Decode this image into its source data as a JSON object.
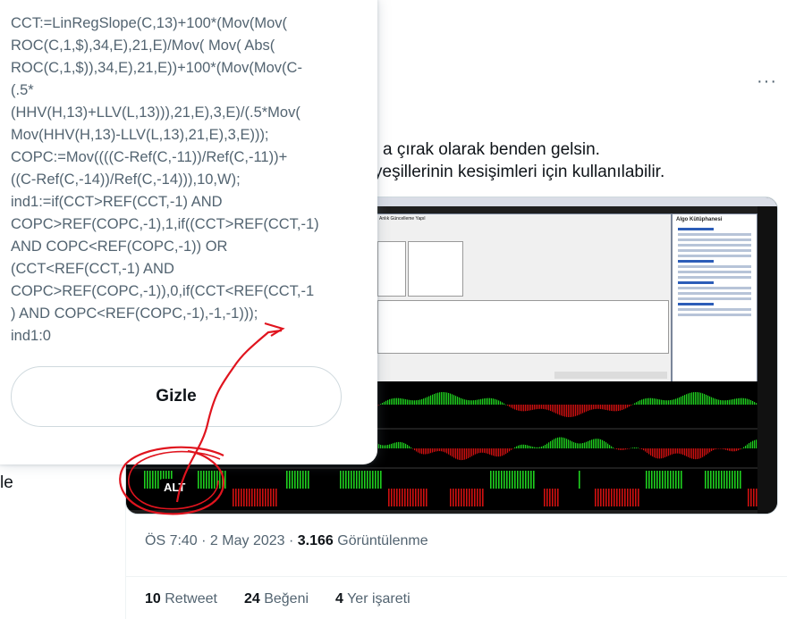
{
  "tweet": {
    "text_line1": "a çırak olarak benden gelsin.",
    "text_line2": "yeşillerinin kesişimleri için kullanılabilir.",
    "more_label": "···",
    "left_stub": "le",
    "timestamp": "ÖS 7:40 · 2 May 2023 · ",
    "views_count": "3.166",
    "views_label": " Görüntülenme",
    "retweets_count": "10",
    "retweets_label": "Retweet",
    "likes_count": "24",
    "likes_label": "Beğeni",
    "bookmarks_count": "4",
    "bookmarks_label": "Yer işareti"
  },
  "popup": {
    "code": "CCT:=LinRegSlope(C,13)+100*(Mov(Mov(\nROC(C,1,$),34,E),21,E)/Mov( Mov( Abs(\nROC(C,1,$)),34,E),21,E))+100*(Mov(Mov(C-\n(.5*\n(HHV(H,13)+LLV(L,13))),21,E),3,E)/(.5*Mov(\nMov(HHV(H,13)-LLV(L,13),21,E),3,E)));\nCOPC:=Mov((((C-Ref(C,-11))/Ref(C,-11))+\n((C-Ref(C,-14))/Ref(C,-14))),10,W);\nind1:=if(CCT>REF(CCT,-1) AND\nCOPC>REF(COPC,-1),1,if((CCT>REF(CCT,-1)\nAND COPC<REF(COPC,-1)) OR\n(CCT<REF(CCT,-1) AND\nCOPC>REF(COPC,-1)),0,if(CCT<REF(CCT,-1\n) AND COPC<REF(COPC,-1),-1,-1)));\nind1:0",
    "hide_button": "Gizle"
  },
  "image": {
    "alt_badge": "ALT",
    "side_panel_title": "Algo Kütüphanesi",
    "dialog_title": "Anlık Güncelleme Yapıl"
  },
  "colors": {
    "annotation": "#e0141e",
    "bull": "#1fd01f",
    "bear": "#d01010"
  }
}
